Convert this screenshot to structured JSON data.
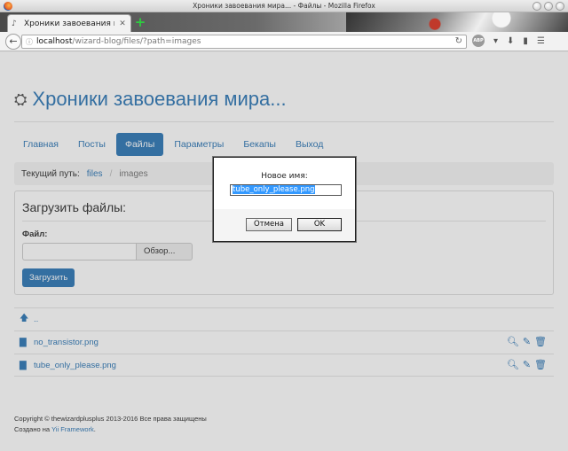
{
  "window": {
    "title": "Хроники завоевания мира... - Файлы - Mozilla Firefox"
  },
  "browser": {
    "tab_title": "Хроники завоевания ми...",
    "url_host": "localhost",
    "url_path": "/wizard-blog/files/?path=images"
  },
  "site": {
    "title": "Хроники завоевания мира..."
  },
  "nav": {
    "items": [
      {
        "label": "Главная"
      },
      {
        "label": "Посты"
      },
      {
        "label": "Файлы"
      },
      {
        "label": "Параметры"
      },
      {
        "label": "Бекапы"
      },
      {
        "label": "Выход"
      }
    ]
  },
  "breadcrumb": {
    "label": "Текущий путь:",
    "link": "files",
    "separator": "/",
    "current": "images"
  },
  "upload": {
    "title": "Загрузить файлы:",
    "file_label": "Файл:",
    "browse_label": "Обзор...",
    "submit_label": "Загрузить"
  },
  "files": {
    "up_label": "..",
    "rows": [
      {
        "name": "no_transistor.png"
      },
      {
        "name": "tube_only_please.png"
      }
    ]
  },
  "footer": {
    "copyright": "Copyright © thewizardplusplus 2013-2016 Все права защищены",
    "made_with": "Создано на",
    "framework": "Yii Framework",
    "dot": "."
  },
  "dialog": {
    "label": "Новое имя:",
    "value": "tube_only_please.png",
    "cancel_label": "Отмена",
    "ok_label": "OK"
  }
}
